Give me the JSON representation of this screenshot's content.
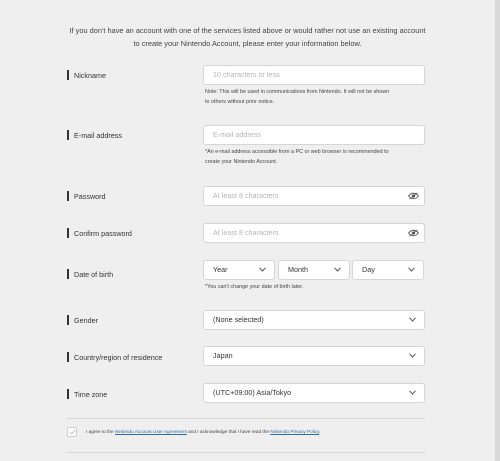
{
  "intro": {
    "line1": "If you don't have an account with one of the services listed above or would rather not use an existing account",
    "line2": "to create your Nintendo Account, please enter your information below."
  },
  "nickname": {
    "label": "Nickname",
    "placeholder": "10 characters or less",
    "note_line1": "Note: This will be used in communications from Nintendo. It will not be shown",
    "note_line2": "to others without prior notice."
  },
  "email": {
    "label": "E-mail address",
    "placeholder": "E-mail address",
    "note_line1": "*An e-mail address accessible from a PC or web browser is recommended to",
    "note_line2": "create your Nintendo Account."
  },
  "password": {
    "label": "Password",
    "placeholder": "At least 8 characters"
  },
  "confirm_password": {
    "label": "Confirm password",
    "placeholder": "At least 8 characters"
  },
  "dob": {
    "label": "Date of birth",
    "year": "Year",
    "month": "Month",
    "day": "Day",
    "note": "*You can't change your date of birth later."
  },
  "gender": {
    "label": "Gender",
    "value": "(None selected)"
  },
  "country": {
    "label": "Country/region of residence",
    "value": "Japan"
  },
  "timezone": {
    "label": "Time zone",
    "value": "(UTC+09:00) Asia/Tokyo"
  },
  "agreement": {
    "prefix": "I agree to the ",
    "link1": "Nintendo Account User Agreement",
    "middle": " and I acknowledge that I have read the ",
    "link2": "Nintendo Privacy Policy",
    "suffix": "."
  },
  "icons": {
    "eye": "eye-icon",
    "chevron": "chevron-down-icon",
    "check": "check-icon"
  }
}
